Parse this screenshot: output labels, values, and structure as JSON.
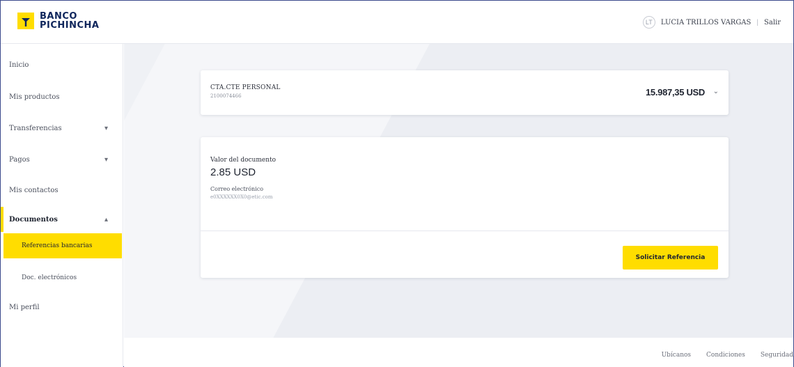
{
  "brand": {
    "line1": "BANCO",
    "line2": "PICHINCHA"
  },
  "header": {
    "avatar_initials": "LT",
    "username": "LUCIA TRILLOS VARGAS",
    "separator": "|",
    "logout_label": "Salir"
  },
  "sidebar": {
    "items": [
      {
        "label": "Inicio"
      },
      {
        "label": "Mis productos"
      },
      {
        "label": "Transferencias",
        "chevron": "▾"
      },
      {
        "label": "Pagos",
        "chevron": "▾"
      },
      {
        "label": "Mis contactos"
      },
      {
        "label": "Documentos",
        "chevron": "▴"
      },
      {
        "label": "Mi perfil"
      }
    ],
    "subitems": [
      {
        "label": "Referencias bancarias"
      },
      {
        "label": "Doc. electrónicos"
      }
    ]
  },
  "account": {
    "name": "CTA.CTE PERSONAL",
    "number": "2100074466",
    "balance": "15.987,35 USD",
    "chevron": "⌄"
  },
  "document": {
    "value_label": "Valor del documento",
    "value": "2.85 USD",
    "email_label": "Correo electrónico",
    "email_value": "e0XXXXXX0X0@etic.com",
    "button_label": "Solicitar Referencia"
  },
  "footer": {
    "links": [
      "Ubícanos",
      "Condiciones",
      "Seguridad"
    ]
  },
  "colors": {
    "accent": "#ffdd00",
    "brand": "#0f265c",
    "background": "#eff1f5"
  }
}
